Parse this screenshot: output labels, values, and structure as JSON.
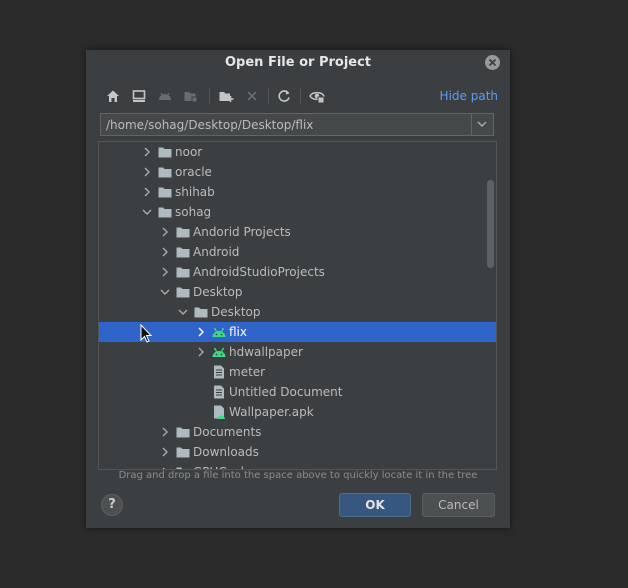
{
  "dialog": {
    "title": "Open File or Project",
    "hide_path_label": "Hide path",
    "path_value": "/home/sohag/Desktop/Desktop/flix",
    "hint": "Drag and drop a file into the space above to quickly locate it in the tree",
    "ok_label": "OK",
    "cancel_label": "Cancel",
    "help_label": "?"
  },
  "toolbar": {
    "buttons": [
      "home-icon",
      "desktop-icon",
      "android-icon",
      "module-folder-icon",
      "new-folder-icon",
      "delete-icon",
      "refresh-icon",
      "show-hidden-icon"
    ]
  },
  "tree": {
    "rows": [
      {
        "label": "noor",
        "depth": 0,
        "expanded": false,
        "kind": "folder"
      },
      {
        "label": "oracle",
        "depth": 0,
        "expanded": false,
        "kind": "folder"
      },
      {
        "label": "shihab",
        "depth": 0,
        "expanded": false,
        "kind": "folder"
      },
      {
        "label": "sohag",
        "depth": 0,
        "expanded": true,
        "kind": "folder"
      },
      {
        "label": "Andorid Projects",
        "depth": 1,
        "expanded": false,
        "kind": "folder"
      },
      {
        "label": "Android",
        "depth": 1,
        "expanded": false,
        "kind": "folder"
      },
      {
        "label": "AndroidStudioProjects",
        "depth": 1,
        "expanded": false,
        "kind": "folder"
      },
      {
        "label": "Desktop",
        "depth": 1,
        "expanded": true,
        "kind": "folder"
      },
      {
        "label": "Desktop",
        "depth": 2,
        "expanded": true,
        "kind": "folder",
        "nochev": false
      },
      {
        "label": "flix",
        "depth": 3,
        "expanded": false,
        "kind": "android",
        "selected": true
      },
      {
        "label": "hdwallpaper",
        "depth": 3,
        "expanded": false,
        "kind": "android"
      },
      {
        "label": "meter",
        "depth": 3,
        "kind": "file"
      },
      {
        "label": "Untitled Document",
        "depth": 3,
        "kind": "file"
      },
      {
        "label": "Wallpaper.apk",
        "depth": 3,
        "kind": "apk"
      },
      {
        "label": "Documents",
        "depth": 1,
        "expanded": false,
        "kind": "folder"
      },
      {
        "label": "Downloads",
        "depth": 1,
        "expanded": false,
        "kind": "folder"
      },
      {
        "label": "GPUCache",
        "depth": 1,
        "expanded": false,
        "kind": "folder"
      }
    ]
  },
  "colors": {
    "selection": "#2f65ca",
    "android_green": "#3ddc84",
    "link": "#589df6"
  }
}
